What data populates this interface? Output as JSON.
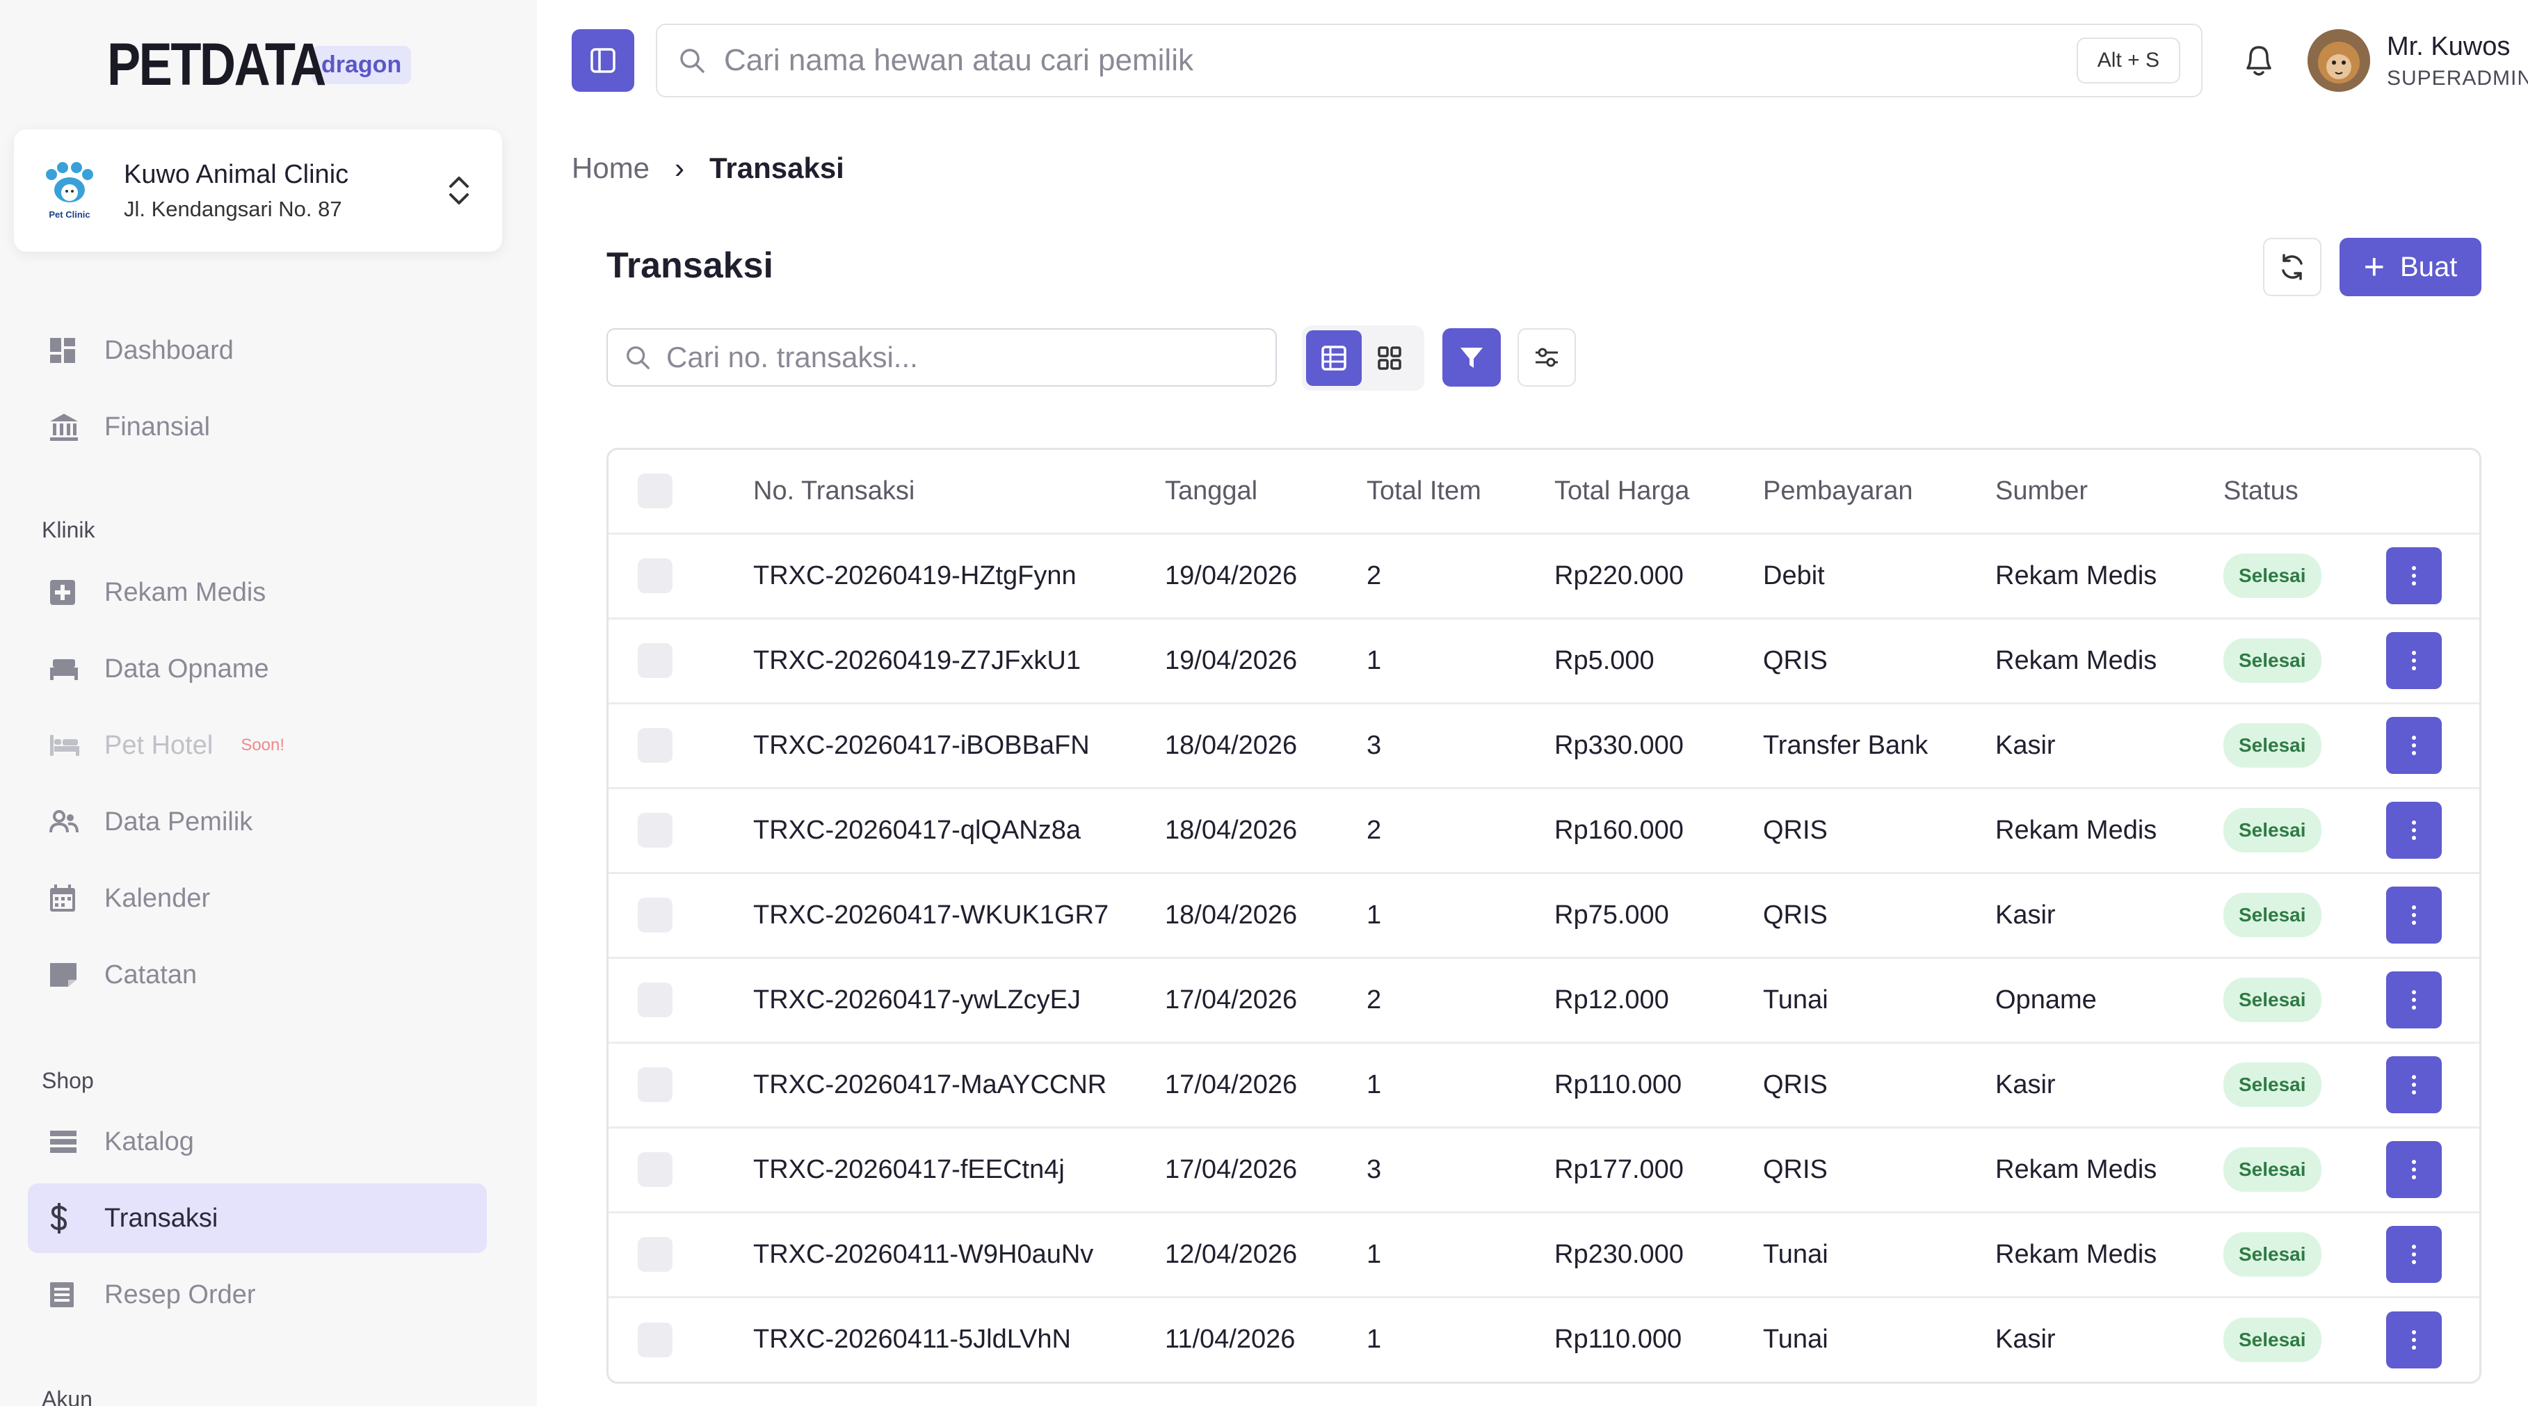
{
  "brand": {
    "logo_text": "PETDATA",
    "env_badge": "dragon"
  },
  "clinic": {
    "name": "Kuwo Animal Clinic",
    "address": "Jl. Kendangsari No. 87",
    "logo_caption": "Pet Clinic"
  },
  "sidebar": {
    "items_top": [
      {
        "label": "Dashboard",
        "icon": "dashboard-icon"
      },
      {
        "label": "Finansial",
        "icon": "bank-icon"
      }
    ],
    "section_klinik": "Klinik",
    "items_klinik": [
      {
        "label": "Rekam Medis",
        "icon": "medical-plus-icon"
      },
      {
        "label": "Data Opname",
        "icon": "bed-icon"
      },
      {
        "label": "Pet Hotel",
        "icon": "hotel-bed-icon",
        "badge": "Soon!"
      },
      {
        "label": "Data Pemilik",
        "icon": "people-icon"
      },
      {
        "label": "Kalender",
        "icon": "calendar-icon"
      },
      {
        "label": "Catatan",
        "icon": "note-icon"
      }
    ],
    "section_shop": "Shop",
    "items_shop": [
      {
        "label": "Katalog",
        "icon": "list-icon"
      },
      {
        "label": "Transaksi",
        "icon": "dollar-icon",
        "active": true
      },
      {
        "label": "Resep Order",
        "icon": "receipt-icon"
      }
    ],
    "section_akun": "Akun"
  },
  "topbar": {
    "search_placeholder": "Cari nama hewan atau cari pemilik",
    "search_shortcut": "Alt + S",
    "user_name": "Mr. Kuwos",
    "user_role": "SUPERADMIN"
  },
  "breadcrumb": {
    "home": "Home",
    "separator": "›",
    "current": "Transaksi"
  },
  "page": {
    "title": "Transaksi",
    "create_label": "Buat",
    "search_placeholder": "Cari no. transaksi..."
  },
  "table": {
    "columns": [
      "No. Transaksi",
      "Tanggal",
      "Total Item",
      "Total Harga",
      "Pembayaran",
      "Sumber",
      "Status"
    ],
    "rows": [
      {
        "no": "TRXC-20260419-HZtgFynn",
        "date": "19/04/2026",
        "items": "2",
        "total": "Rp220.000",
        "payment": "Debit",
        "source": "Rekam Medis",
        "status": "Selesai"
      },
      {
        "no": "TRXC-20260419-Z7JFxkU1",
        "date": "19/04/2026",
        "items": "1",
        "total": "Rp5.000",
        "payment": "QRIS",
        "source": "Rekam Medis",
        "status": "Selesai"
      },
      {
        "no": "TRXC-20260417-iBOBBaFN",
        "date": "18/04/2026",
        "items": "3",
        "total": "Rp330.000",
        "payment": "Transfer Bank",
        "source": "Kasir",
        "status": "Selesai"
      },
      {
        "no": "TRXC-20260417-qlQANz8a",
        "date": "18/04/2026",
        "items": "2",
        "total": "Rp160.000",
        "payment": "QRIS",
        "source": "Rekam Medis",
        "status": "Selesai"
      },
      {
        "no": "TRXC-20260417-WKUK1GR7",
        "date": "18/04/2026",
        "items": "1",
        "total": "Rp75.000",
        "payment": "QRIS",
        "source": "Kasir",
        "status": "Selesai"
      },
      {
        "no": "TRXC-20260417-ywLZcyEJ",
        "date": "17/04/2026",
        "items": "2",
        "total": "Rp12.000",
        "payment": "Tunai",
        "source": "Opname",
        "status": "Selesai"
      },
      {
        "no": "TRXC-20260417-MaAYCCNR",
        "date": "17/04/2026",
        "items": "1",
        "total": "Rp110.000",
        "payment": "QRIS",
        "source": "Kasir",
        "status": "Selesai"
      },
      {
        "no": "TRXC-20260417-fEECtn4j",
        "date": "17/04/2026",
        "items": "3",
        "total": "Rp177.000",
        "payment": "QRIS",
        "source": "Rekam Medis",
        "status": "Selesai"
      },
      {
        "no": "TRXC-20260411-W9H0auNv",
        "date": "12/04/2026",
        "items": "1",
        "total": "Rp230.000",
        "payment": "Tunai",
        "source": "Rekam Medis",
        "status": "Selesai"
      },
      {
        "no": "TRXC-20260411-5JldLVhN",
        "date": "11/04/2026",
        "items": "1",
        "total": "Rp110.000",
        "payment": "Tunai",
        "source": "Kasir",
        "status": "Selesai"
      }
    ]
  },
  "colors": {
    "accent": "#5f5bd0",
    "active_nav_bg": "#e4e3fb",
    "status_bg": "#dcf5e2",
    "status_text": "#2f7a45"
  }
}
